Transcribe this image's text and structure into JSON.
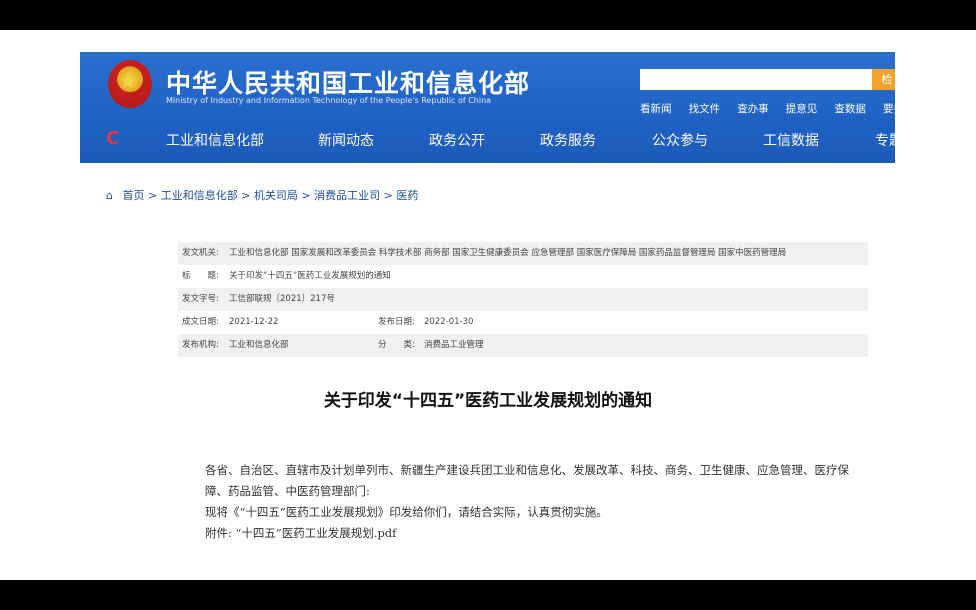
{
  "header": {
    "title_cn": "中华人民共和国工业和信息化部",
    "title_en": "Ministry of Industry and Information Technology of the People's Republic of China",
    "search_placeholder": "",
    "search_button": "检",
    "quick_links": [
      "看新闻",
      "找文件",
      "查办事",
      "提意见",
      "查数据",
      "要投诉"
    ]
  },
  "nav": {
    "items": [
      "工业和信息化部",
      "新闻动态",
      "政务公开",
      "政务服务",
      "公众参与",
      "工信数据",
      "专题"
    ]
  },
  "breadcrumb": {
    "items": [
      "首页",
      "工业和信息化部",
      "机关司局",
      "消费品工业司",
      "医药"
    ],
    "separator": ">"
  },
  "meta": {
    "issuer_label": "发文机关:",
    "issuer_value": "工业和信息化部 国家发展和改革委员会 科学技术部 商务部 国家卫生健康委员会 应急管理部 国家医疗保障局 国家药品监督管理局 国家中医药管理局",
    "title_label": "标　　题:",
    "title_value": "关于印发“十四五”医药工业发展规划的通知",
    "number_label": "发文字号:",
    "number_value": "工信部联规〔2021〕217号",
    "written_label": "成文日期:",
    "written_value": "2021-12-22",
    "published_label": "发布日期:",
    "published_value": "2022-01-30",
    "agency_label": "发布机构:",
    "agency_value": "工业和信息化部",
    "category_label": "分　　类:",
    "category_value": "消费品工业管理"
  },
  "doc": {
    "title": "关于印发“十四五”医药工业发展规划的通知",
    "para1": "各省、自治区、直辖市及计划单列市、新疆生产建设兵团工业和信息化、发展改革、科技、商务、卫生健康、应急管理、医疗保障、药品监管、中医药管理部门:",
    "para2": "现将《“十四五”医药工业发展规划》印发给你们，请结合实际，认真贯彻实施。",
    "attachment_label": "附件:",
    "attachment_link": "“十四五”医药工业发展规划.pdf"
  }
}
